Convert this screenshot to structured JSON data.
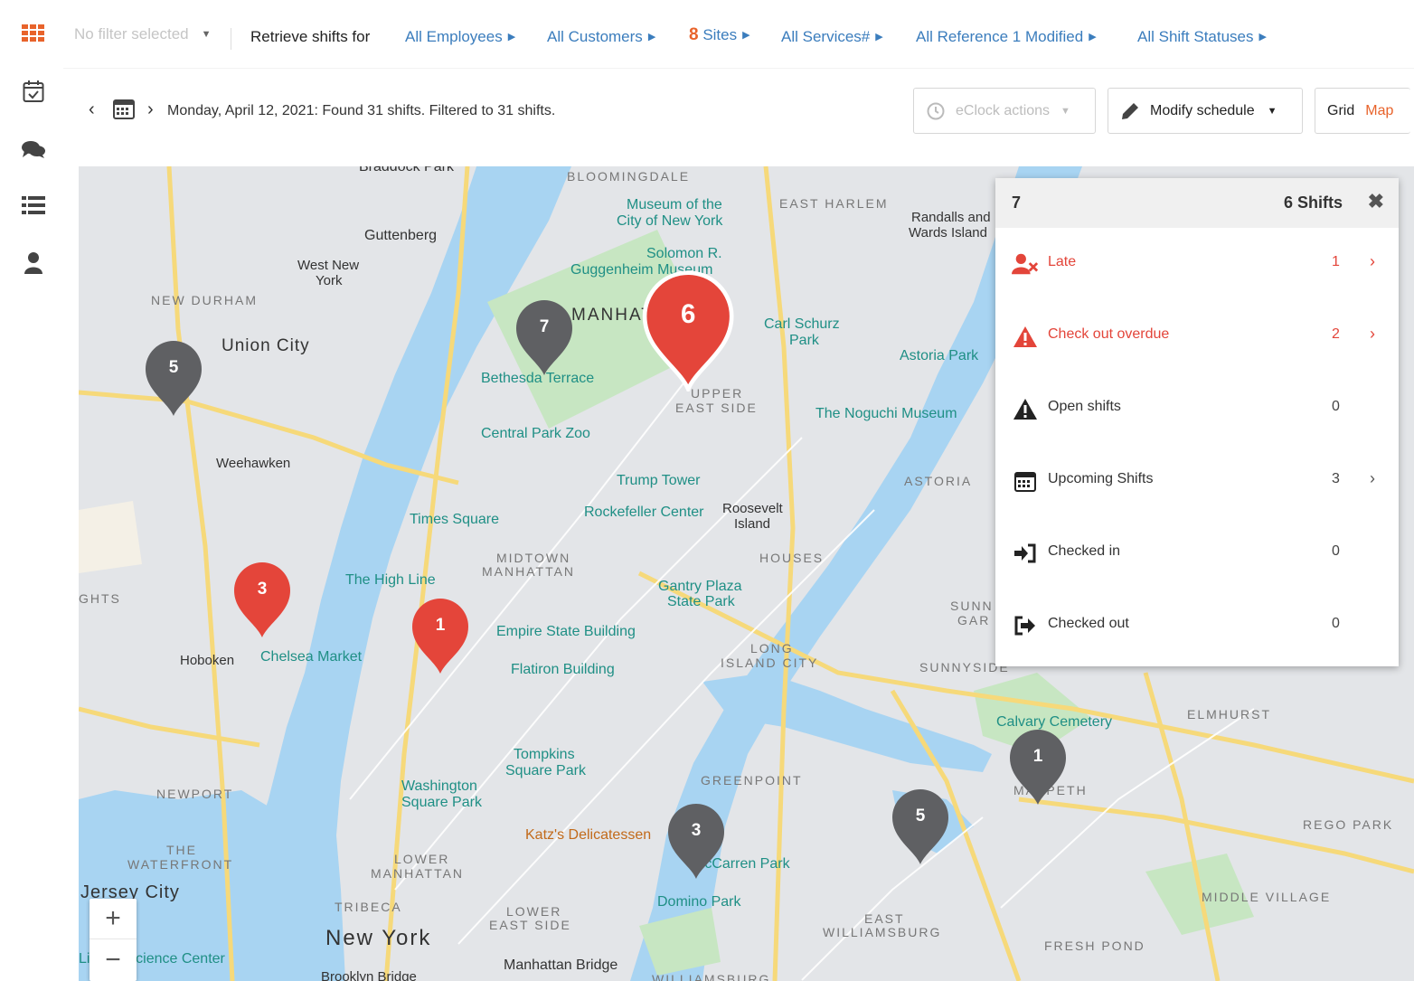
{
  "topbar": {
    "filter_placeholder": "No filter selected",
    "retrieve_label": "Retrieve shifts for",
    "employees": "All Employees",
    "customers": "All Customers",
    "sites_count": "8",
    "sites_label": "Sites",
    "services": "All Services#",
    "reference": "All Reference 1 Modified",
    "statuses": "All Shift Statuses"
  },
  "datebar": {
    "summary": "Monday, April 12, 2021: Found 31 shifts. Filtered to 31 shifts.",
    "eclock_label": "eClock actions",
    "modify_label": "Modify schedule",
    "view_grid": "Grid",
    "view_map": "Map"
  },
  "map": {
    "labels": {
      "braddock": "Braddock Park",
      "bloomingdale": "BLOOMINGDALE",
      "museum": "Museum of the",
      "museum2": "City of New York",
      "east_harlem": "EAST HARLEM",
      "randalls": "Randalls and",
      "randalls2": "Wards Island",
      "guttenberg": "Guttenberg",
      "solomon": "Solomon R.",
      "guggenheim": "Guggenheim Museum",
      "west_new_york": "West New",
      "west_new_york2": "York",
      "new_durham": "NEW DURHAM",
      "union_city": "Union City",
      "manhattan": "MANHATTAN",
      "carl": "Carl Schurz",
      "carl2": "Park",
      "astoria_park": "Astoria Park",
      "bethesda": "Bethesda Terrace",
      "upper": "UPPER",
      "upper2": "EAST SIDE",
      "noguchi": "The Noguchi Museum",
      "central_zoo": "Central Park Zoo",
      "weehawken": "Weehawken",
      "trump": "Trump Tower",
      "astoria": "ASTORIA",
      "times_square": "Times Square",
      "rockefeller": "Rockefeller Center",
      "roosevelt": "Roosevelt",
      "roosevelt2": "Island",
      "midtown": "MIDTOWN",
      "midtown2": "MANHATTAN",
      "houses": "HOUSES",
      "high_line": "The High Line",
      "gantry": "Gantry Plaza",
      "gantry2": "State Park",
      "heights": "GHTS",
      "sunnyside_gardens": "SUNN",
      "sunnyside_gardens2": "GAR",
      "empire": "Empire State Building",
      "hoboken": "Hoboken",
      "chelsea": "Chelsea Market",
      "lic": "LONG",
      "lic2": "ISLAND CITY",
      "sunnyside": "SUNNYSIDE",
      "flatiron": "Flatiron Building",
      "calvary": "Calvary Cemetery",
      "elmhurst": "ELMHURST",
      "tompkins": "Tompkins",
      "tompkins2": "Square Park",
      "washington": "Washington",
      "washington2": "Square Park",
      "greenpoint": "GREENPOINT",
      "newport": "NEWPORT",
      "maspeth": "MASPETH",
      "katz": "Katz's Delicatessen",
      "the_waterfront": "THE",
      "the_waterfront2": "WATERFRONT",
      "rego": "REGO PARK",
      "lower_manhattan": "LOWER",
      "lower_manhattan2": "MANHATTAN",
      "mccarren": "McCarren Park",
      "jersey_city": "Jersey City",
      "domino": "Domino Park",
      "middle_village": "MIDDLE VILLAGE",
      "tribeca": "TRIBECA",
      "lower_east": "LOWER",
      "lower_east2": "EAST SIDE",
      "east_wburg": "EAST",
      "east_wburg2": "WILLIAMSBURG",
      "new_york": "New York",
      "science": "Liberty Science Center",
      "fresh_pond": "FRESH POND",
      "brooklyn_bridge": "Brooklyn Bridge",
      "manhattan_bridge": "Manhattan Bridge",
      "williamsburg": "WILLIAMSBURG"
    },
    "markers": [
      {
        "count": "5",
        "color": "#5f6063"
      },
      {
        "count": "7",
        "color": "#5f6063"
      },
      {
        "count": "6",
        "color": "#e4453a"
      },
      {
        "count": "3",
        "color": "#e4453a"
      },
      {
        "count": "1",
        "color": "#e4453a"
      },
      {
        "count": "3",
        "color": "#5f6063"
      },
      {
        "count": "5",
        "color": "#5f6063"
      },
      {
        "count": "1",
        "color": "#5f6063"
      }
    ],
    "zoom_in": "+",
    "zoom_out": "−"
  },
  "panel": {
    "cluster_id": "7",
    "shift_count": "6 Shifts",
    "close": "✖",
    "rows": [
      {
        "label": "Late",
        "value": "1",
        "chevron": "›",
        "icon": "user-times-icon"
      },
      {
        "label": "Check out overdue",
        "value": "2",
        "chevron": "›",
        "icon": "warning-icon"
      },
      {
        "label": "Open shifts",
        "value": "0",
        "icon": "warning-icon"
      },
      {
        "label": "Upcoming Shifts",
        "value": "3",
        "chevron": "›",
        "icon": "calendar-icon"
      },
      {
        "label": "Checked in",
        "value": "0",
        "icon": "sign-in-icon"
      },
      {
        "label": "Checked out",
        "value": "0",
        "icon": "sign-out-icon"
      }
    ]
  },
  "colors": {
    "accent": "#e8632b",
    "link": "#3b7dbd",
    "alert": "#e3453a",
    "water": "#a8d4f2"
  }
}
